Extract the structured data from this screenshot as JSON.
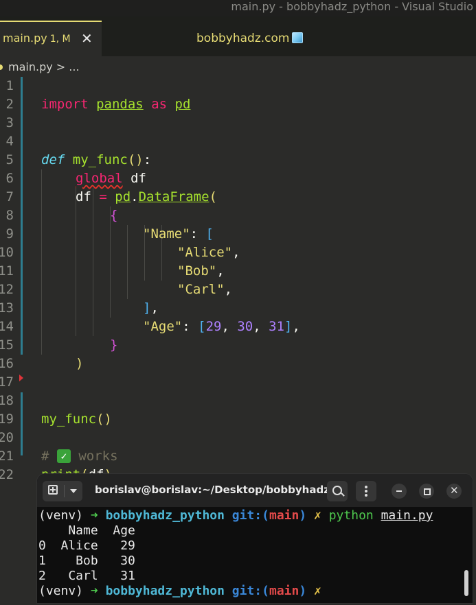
{
  "window": {
    "title": "main.py - bobbyhadz_python - Visual Studio"
  },
  "tabs": {
    "active_label": "main.py",
    "active_badge": "1, M",
    "close_glyph": "✕"
  },
  "brand": {
    "text": "bobbyhadz.com"
  },
  "breadcrumb": {
    "file": "main.py",
    "separator": ">",
    "more": "..."
  },
  "editor": {
    "line_numbers": [
      "1",
      "2",
      "3",
      "4",
      "5",
      "6",
      "7",
      "8",
      "9",
      "10",
      "11",
      "12",
      "13",
      "14",
      "15",
      "16",
      "17",
      "18",
      "19",
      "20",
      "21",
      "22"
    ],
    "line1": {
      "kw1": "import",
      "mod": "pandas",
      "kw2": "as",
      "alias": "pd"
    },
    "line4": {
      "kw": "def",
      "name": "my_func",
      "parens": "()",
      "colon": ":"
    },
    "line5": {
      "kw": "global",
      "name": "df"
    },
    "line6": {
      "lhs": "df",
      "eq": "=",
      "mod": "pd",
      "dot": ".",
      "cls": "DataFrame",
      "open": "("
    },
    "line7": {
      "brace": "{"
    },
    "line8": {
      "key": "\"Name\"",
      "colon": ":",
      "open": "["
    },
    "line9": {
      "val": "\"Alice\"",
      "comma": ","
    },
    "line10": {
      "val": "\"Bob\"",
      "comma": ","
    },
    "line11": {
      "val": "\"Carl\"",
      "comma": ","
    },
    "line12": {
      "close": "]",
      "comma": ","
    },
    "line13": {
      "key": "\"Age\"",
      "colon": ":",
      "open": "[",
      "n1": "29",
      "n2": "30",
      "n3": "31",
      "close": "]",
      "sep": ",",
      "comma": ","
    },
    "line14": {
      "brace": "}"
    },
    "line15": {
      "close": ")"
    },
    "line18": {
      "call": "my_func",
      "parens": "()"
    },
    "line20": {
      "hash": "#",
      "check": "✓",
      "text": "works"
    },
    "line21": {
      "fn": "print",
      "open": "(",
      "arg": "df",
      "close": ")"
    }
  },
  "terminal": {
    "title": "borislav@borislav:~/Desktop/bobbyhadz_...",
    "prompt": {
      "venv": "(venv)",
      "arrow": "➜",
      "dir": "bobbyhadz_python",
      "git": "git:(",
      "branch": "main",
      "git_close": ")",
      "dirty": "✗"
    },
    "command": {
      "cmd": "python",
      "arg": "main.py"
    },
    "output": {
      "header": "    Name  Age",
      "rows": [
        "0  Alice   29",
        "1    Bob   30",
        "2   Carl   31"
      ]
    }
  },
  "colors": {
    "editor_bg": "#2b2b29",
    "keyword": "#f92672",
    "function": "#a6e22e",
    "string": "#e6db74",
    "number": "#ae81ff",
    "terminal_bg": "#0e0e0e"
  }
}
